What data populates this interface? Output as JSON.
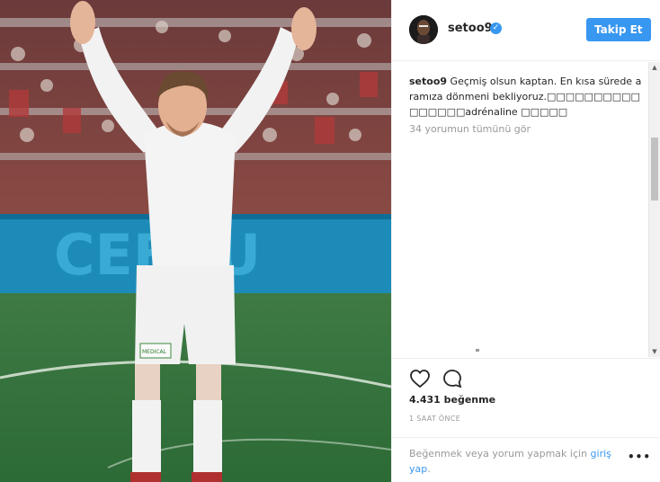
{
  "post": {
    "username": "setoo9",
    "follow_label": "Takip Et",
    "caption_user": "setoo9",
    "caption_text": "Geçmiş olsun kaptan. En kısa sürede aramıza dönmeni bekliyoruz.□□□□□□□□□□□□□□□□adrénaline □□□□□",
    "view_all_comments": "34 yorumun tümünü gör",
    "likes": "4.431 beğenme",
    "time": "1 SAAT ÖNCE",
    "login_prompt": "Beğenmek veya yorum yapmak için ",
    "login_link": "giriş yap",
    "login_suffix": ".",
    "more": "•••"
  },
  "photo": {
    "banner_text": "CEBSU",
    "shorts_badge": "MEDICAL"
  },
  "icons": {
    "verified": "check-badge-icon",
    "like": "heart-outline-icon",
    "comment": "speech-bubble-icon",
    "scroll_up": "triangle-up-icon",
    "scroll_down": "triangle-down-icon"
  },
  "colors": {
    "accent": "#3897f0",
    "text": "#262626",
    "muted": "#999999"
  }
}
